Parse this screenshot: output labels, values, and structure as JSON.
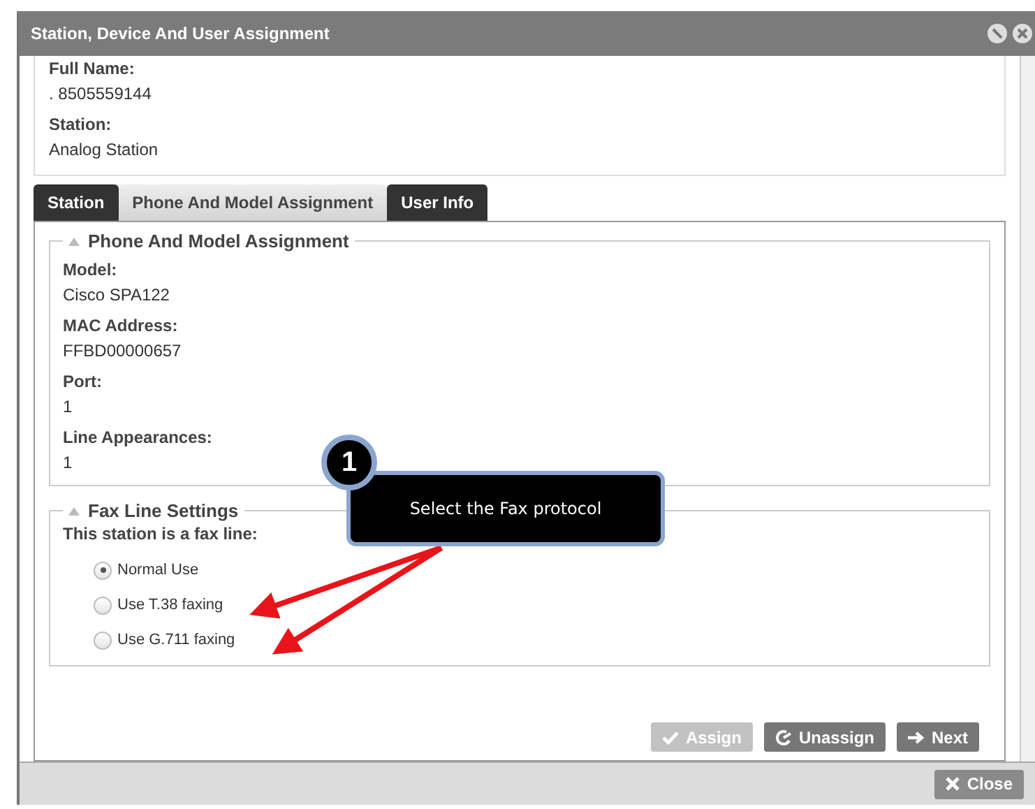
{
  "window": {
    "title": "Station, Device And User Assignment"
  },
  "summary": [
    {
      "label": "Full Name:",
      "value": ". 8505559144"
    },
    {
      "label": "Station:",
      "value": "Analog Station"
    }
  ],
  "tabs": [
    {
      "label": "Station",
      "selected": false
    },
    {
      "label": "Phone And Model Assignment",
      "selected": true
    },
    {
      "label": "User Info",
      "selected": false
    }
  ],
  "phone_section": {
    "title": "Phone And Model Assignment",
    "fields": [
      {
        "label": "Model:",
        "value": "Cisco SPA122"
      },
      {
        "label": "MAC Address:",
        "value": "FFBD00000657"
      },
      {
        "label": "Port:",
        "value": "1"
      },
      {
        "label": "Line Appearances:",
        "value": "1"
      }
    ]
  },
  "fax_section": {
    "title": "Fax Line Settings",
    "prompt": "This station is a fax line:",
    "options": [
      {
        "label": "Normal Use",
        "selected": true
      },
      {
        "label": "Use T.38 faxing",
        "selected": false
      },
      {
        "label": "Use G.711 faxing",
        "selected": false
      }
    ]
  },
  "buttons": [
    {
      "label": "Assign",
      "kind": "assign",
      "disabled": true
    },
    {
      "label": "Unassign",
      "kind": "unassign",
      "disabled": false
    },
    {
      "label": "Next",
      "kind": "next",
      "disabled": false
    }
  ],
  "footer": {
    "close_label": "Close"
  },
  "callout": {
    "step": "1",
    "text": "Select the Fax protocol"
  }
}
